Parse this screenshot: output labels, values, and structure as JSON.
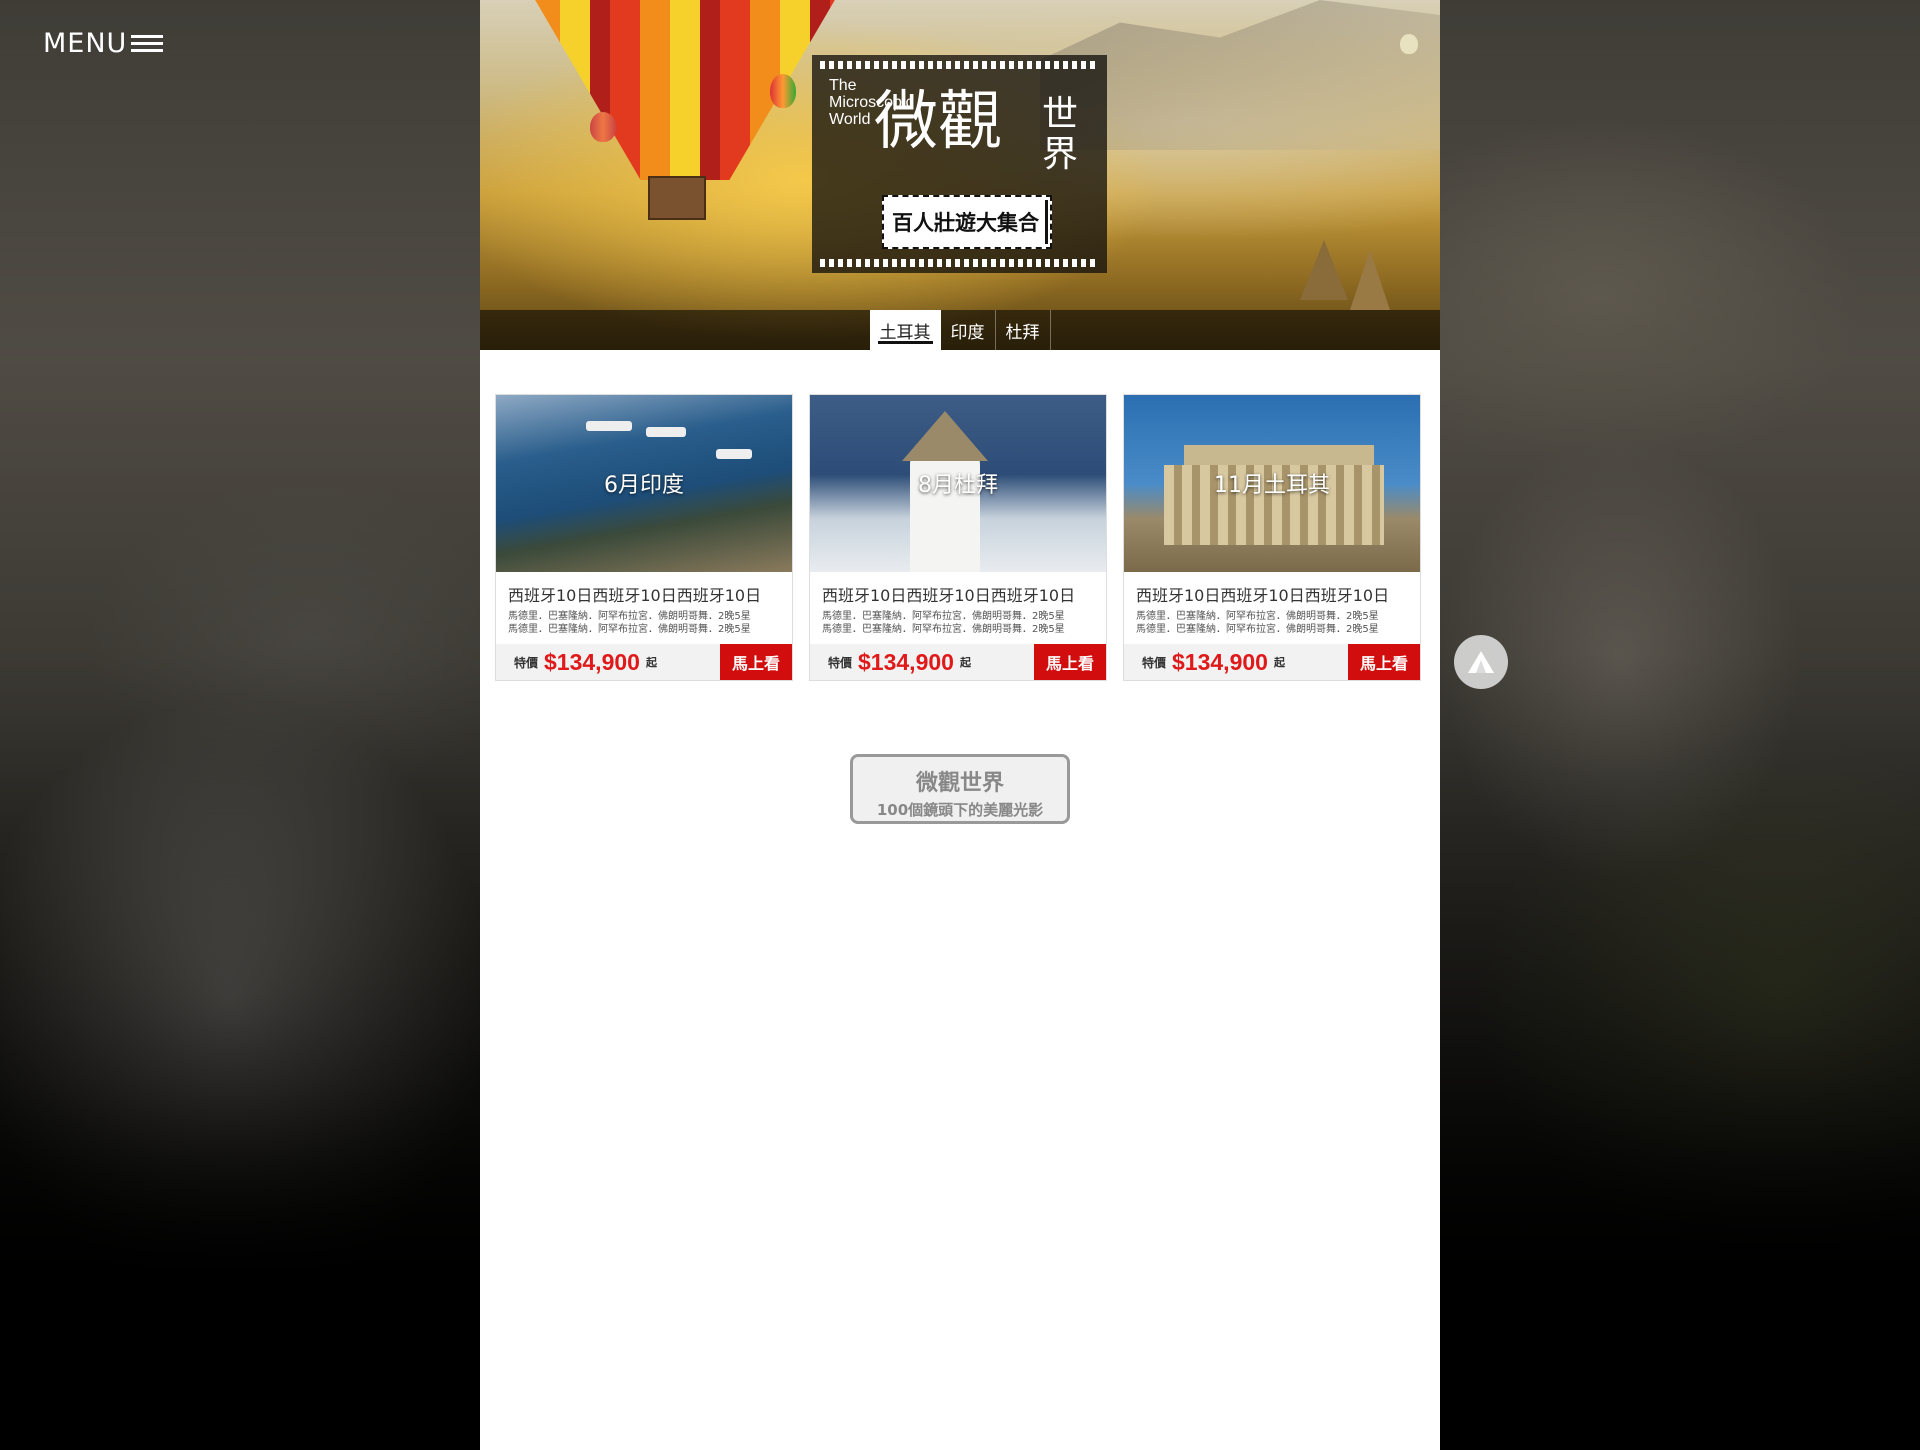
{
  "menu": {
    "label": "MENU"
  },
  "hero": {
    "logo_en": "The Microscopic World",
    "logo_main": "微觀",
    "logo_side": "世界",
    "tagline": "百人壯遊大集合"
  },
  "tabs": [
    {
      "label": "土耳其",
      "active": true
    },
    {
      "label": "印度",
      "active": false
    },
    {
      "label": "杜拜",
      "active": false
    }
  ],
  "cards": [
    {
      "caption": "6月印度",
      "title": "西班牙10日西班牙10日西班牙10日",
      "desc1": "馬德里．巴塞隆納．阿罕布拉宮．佛朗明哥舞．2晚5星",
      "desc2": "馬德里．巴塞隆納．阿罕布拉宮．佛朗明哥舞．2晚5星",
      "price_label": "特價",
      "price": "$134,900",
      "price_suffix": "起",
      "button": "馬上看"
    },
    {
      "caption": "8月杜拜",
      "title": "西班牙10日西班牙10日西班牙10日",
      "desc1": "馬德里．巴塞隆納．阿罕布拉宮．佛朗明哥舞．2晚5星",
      "desc2": "馬德里．巴塞隆納．阿罕布拉宮．佛朗明哥舞．2晚5星",
      "price_label": "特價",
      "price": "$134,900",
      "price_suffix": "起",
      "button": "馬上看"
    },
    {
      "caption": "11月土耳其",
      "title": "西班牙10日西班牙10日西班牙10日",
      "desc1": "馬德里．巴塞隆納．阿罕布拉宮．佛朗明哥舞．2晚5星",
      "desc2": "馬德里．巴塞隆納．阿罕布拉宮．佛朗明哥舞．2晚5星",
      "price_label": "特價",
      "price": "$134,900",
      "price_suffix": "起",
      "button": "馬上看"
    }
  ],
  "more": {
    "title": "微觀世界",
    "subtitle": "100個鏡頭下的美麗光影"
  },
  "icons": {
    "menu": "hamburger-icon",
    "back_to_top": "chevron-up-icon"
  },
  "colors": {
    "price": "#e01a1a",
    "button": "#d10d0d"
  }
}
